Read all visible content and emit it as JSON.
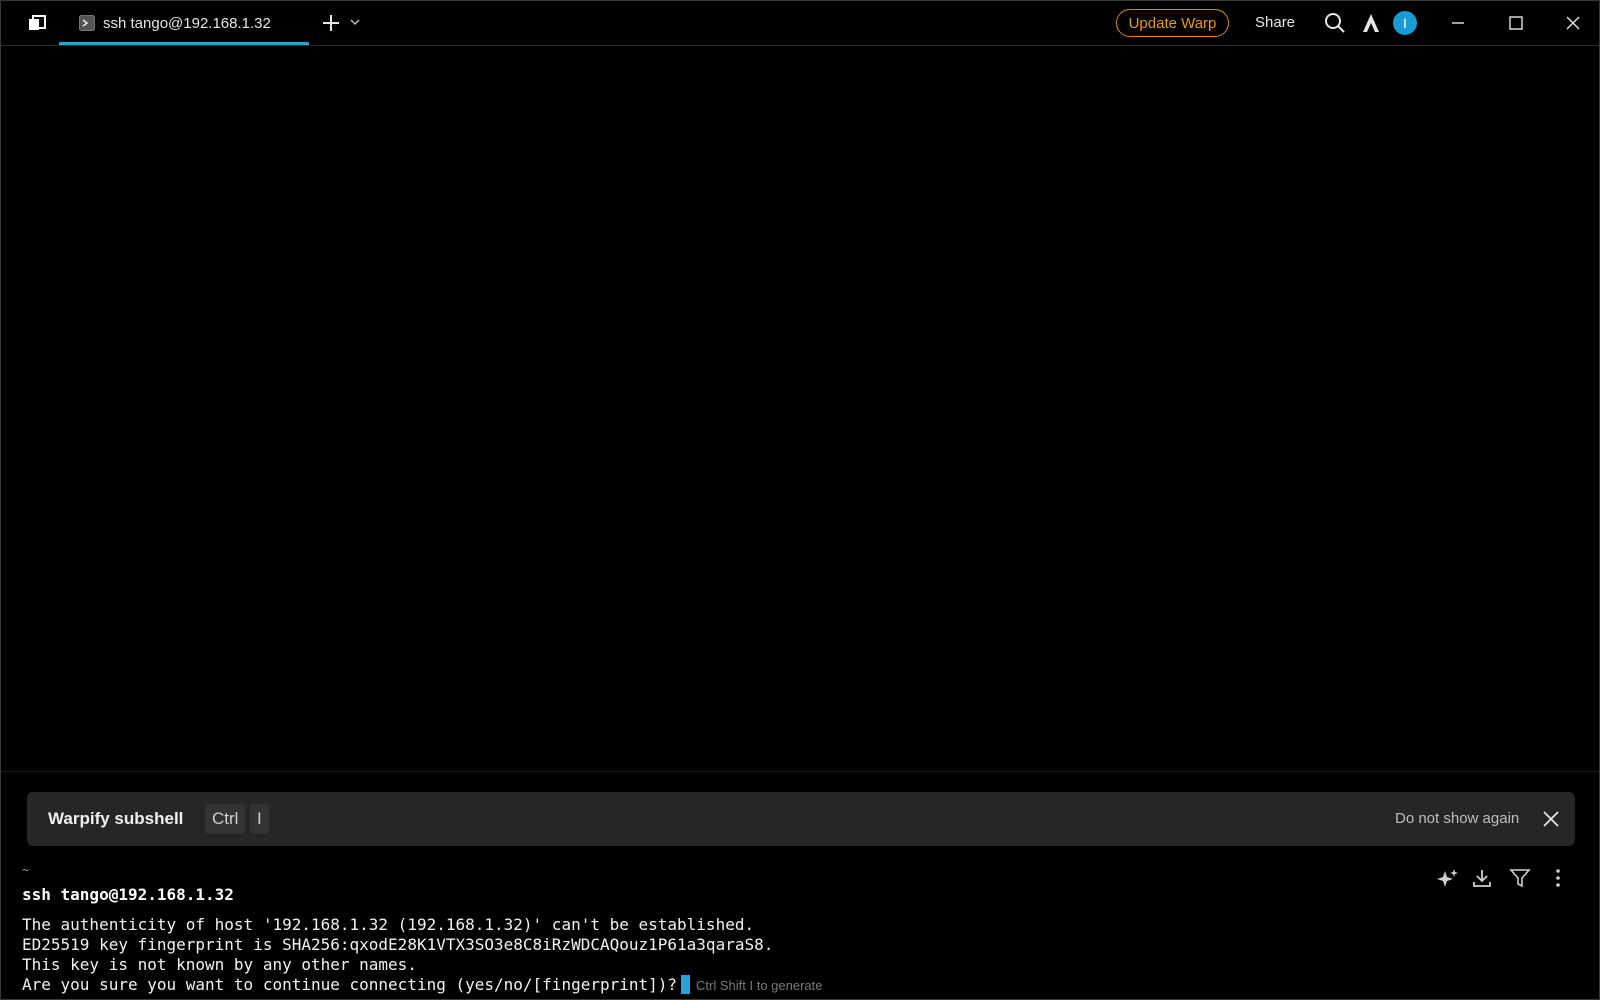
{
  "titlebar": {
    "tab_label": "ssh tango@192.168.1.32",
    "update_label": "Update Warp",
    "share_label": "Share",
    "avatar_letter": "I"
  },
  "banner": {
    "title": "Warpify subshell",
    "key1": "Ctrl",
    "key2": "I",
    "dismiss_label": "Do not show again"
  },
  "block": {
    "cwd": "~",
    "command": "ssh tango@192.168.1.32",
    "output": [
      "The authenticity of host '192.168.1.32 (192.168.1.32)' can't be established.",
      "ED25519 key fingerprint is SHA256:qxodE28K1VTX3SO3e8C8iRzWDCAQouz1P61a3qaraS8.",
      "This key is not known by any other names.",
      "Are you sure you want to continue connecting (yes/no/[fingerprint])?"
    ],
    "input_hint": "Ctrl Shift I to generate"
  },
  "colors": {
    "accent": "#2f9fd0",
    "update_orange": "#e8961f",
    "background": "#000000",
    "banner_bg": "#262626"
  },
  "icons": {
    "app": "warp-logo-icon",
    "tab": "terminal-prompt-icon",
    "new_tab": "plus-icon",
    "new_tab_menu": "chevron-down-icon",
    "search": "search-icon",
    "ai": "warp-ai-icon",
    "minimize": "minimize-icon",
    "maximize": "maximize-icon",
    "close": "close-icon",
    "banner_close": "close-icon",
    "block_ai": "sparkle-icon",
    "block_download": "download-icon",
    "block_filter": "filter-icon",
    "block_more": "more-vertical-icon"
  }
}
